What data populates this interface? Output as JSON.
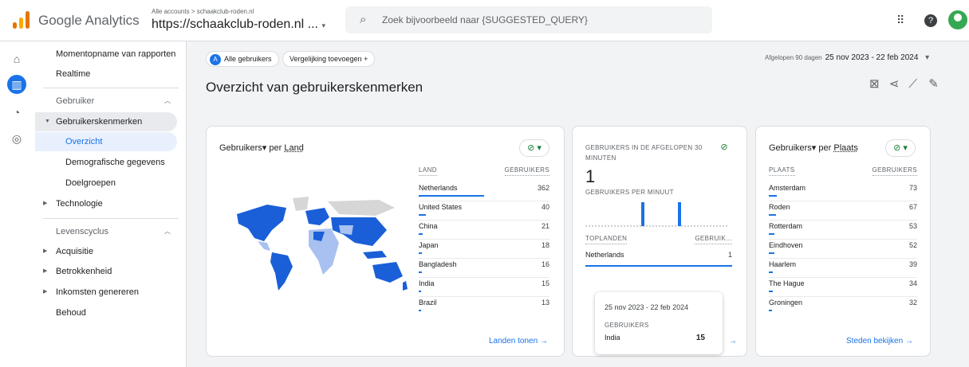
{
  "topbar": {
    "product": "Google Analytics",
    "account_path": "Alle accounts > schaakclub-roden.nl",
    "property": "https://schaakclub-roden.nl ...",
    "search_placeholder": "Zoek bijvoorbeeld naar {SUGGESTED_QUERY}"
  },
  "nav": {
    "snapshot": "Momentopname van rapporten",
    "realtime": "Realtime",
    "section_user": "Gebruiker",
    "user_attributes": "Gebruikerskenmerken",
    "overview": "Overzicht",
    "demographics": "Demografische gegevens",
    "audiences": "Doelgroepen",
    "technology": "Technologie",
    "section_lifecycle": "Levenscyclus",
    "acquisition": "Acquisitie",
    "engagement": "Betrokkenheid",
    "monetization": "Inkomsten genereren",
    "retention": "Behoud"
  },
  "toolbar": {
    "all_users_letter": "A",
    "all_users": "Alle gebruikers",
    "add_comparison": "Vergelijking toevoegen",
    "date_label": "Afgelopen 90 dagen",
    "date_range": "25 nov 2023 - 22 feb 2024"
  },
  "page_title": "Overzicht van gebruikerskenmerken",
  "country_card": {
    "metric": "Gebruikers",
    "by": "per",
    "dimension": "Land",
    "col_dim": "LAND",
    "col_metric": "GEBRUIKERS",
    "rows": [
      {
        "name": "Netherlands",
        "value": "362",
        "pct": 100
      },
      {
        "name": "United States",
        "value": "40",
        "pct": 11
      },
      {
        "name": "China",
        "value": "21",
        "pct": 6
      },
      {
        "name": "Japan",
        "value": "18",
        "pct": 5
      },
      {
        "name": "Bangladesh",
        "value": "16",
        "pct": 4.4
      },
      {
        "name": "India",
        "value": "15",
        "pct": 4.1
      },
      {
        "name": "Brazil",
        "value": "13",
        "pct": 3.6
      }
    ],
    "link": "Landen tonen"
  },
  "realtime_card": {
    "title": "GEBRUIKERS IN DE AFGELOPEN 30 MINUTEN",
    "count": "1",
    "per_minute": "GEBRUIKERS PER MINUUT",
    "col_dim": "TOPLANDEN",
    "col_metric": "GEBRUIK...",
    "rows": [
      {
        "name": "Netherlands",
        "value": "1"
      }
    ]
  },
  "tooltip": {
    "range": "25 nov 2023 - 22 feb 2024",
    "metric": "GEBRUIKERS",
    "name": "India",
    "value": "15"
  },
  "city_card": {
    "metric": "Gebruikers",
    "by": "per",
    "dimension": "Plaats",
    "col_dim": "PLAATS",
    "col_metric": "GEBRUIKERS",
    "rows": [
      {
        "name": "Amsterdam",
        "value": "73",
        "pct": 100
      },
      {
        "name": "Roden",
        "value": "67",
        "pct": 92
      },
      {
        "name": "Rotterdam",
        "value": "53",
        "pct": 73
      },
      {
        "name": "Eindhoven",
        "value": "52",
        "pct": 71
      },
      {
        "name": "Haarlem",
        "value": "39",
        "pct": 53
      },
      {
        "name": "The Hague",
        "value": "34",
        "pct": 47
      },
      {
        "name": "Groningen",
        "value": "32",
        "pct": 44
      }
    ],
    "link": "Steden bekijken"
  },
  "colors": {
    "accent": "#1a73e8",
    "map_dark": "#1a5fd8",
    "map_light": "#a8c1f0",
    "map_none": "#d6d6d6"
  }
}
